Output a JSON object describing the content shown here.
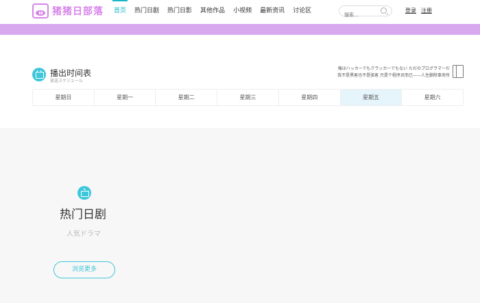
{
  "header": {
    "logo_text": "猪猪日部落",
    "nav": [
      {
        "label": "首页",
        "active": true
      },
      {
        "label": "热门日剧",
        "active": false
      },
      {
        "label": "热门日影",
        "active": false
      },
      {
        "label": "其他作品",
        "active": false
      },
      {
        "label": "小视频",
        "active": false
      },
      {
        "label": "最新资讯",
        "active": false
      },
      {
        "label": "讨论区",
        "active": false
      }
    ],
    "search": {
      "placeholder": "搜索..."
    },
    "login_label": "登录",
    "register_label": "注册"
  },
  "schedule": {
    "title": "播出时间表",
    "subtitle": "放送スケジュール",
    "quote_line1": "俺はハッカーでもクラッカーでもない ただのプログラマーだ",
    "quote_line2": "我不是黑客也不是骇客 只是个程序员而已——人生删除事务所",
    "days": [
      {
        "label": "星期日",
        "active": false
      },
      {
        "label": "星期一",
        "active": false
      },
      {
        "label": "星期二",
        "active": false
      },
      {
        "label": "星期三",
        "active": false
      },
      {
        "label": "星期四",
        "active": false
      },
      {
        "label": "星期五",
        "active": true
      },
      {
        "label": "星期六",
        "active": false
      }
    ]
  },
  "drama": {
    "title": "热门日剧",
    "subtitle": "人気ドラマ",
    "more_label": "浏览更多"
  },
  "colors": {
    "accent": "#1bb5c8",
    "brand": "#d784e8",
    "bar": "#d8a8ef",
    "active_day": "#e6f5fb"
  }
}
